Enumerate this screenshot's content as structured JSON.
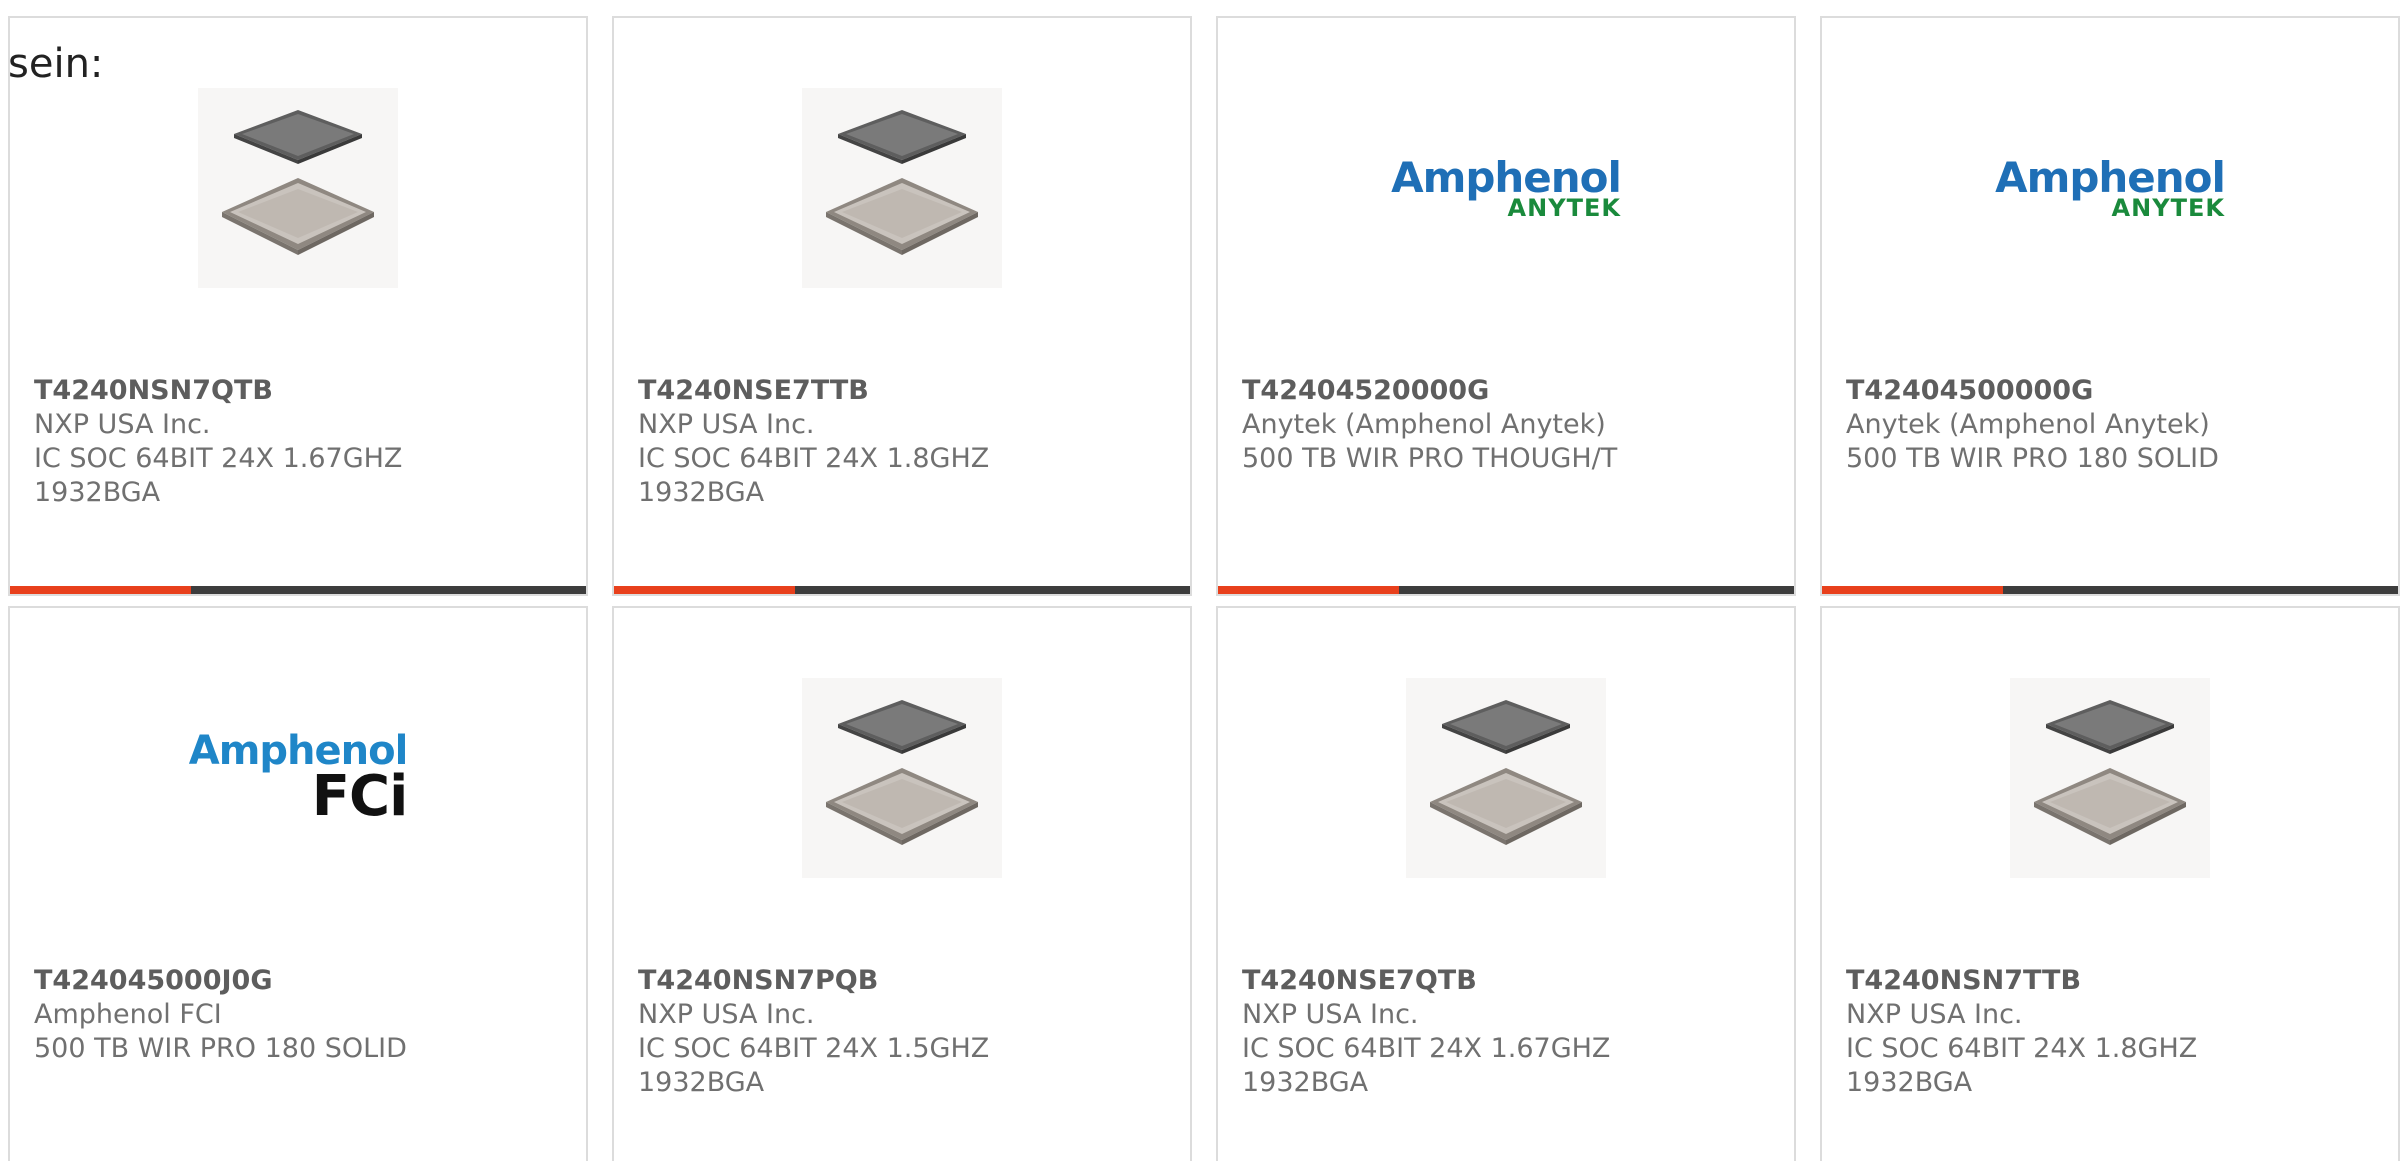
{
  "intro_text": "sein:",
  "products": [
    {
      "part": "T4240NSN7QTB",
      "manufacturer": "NXP USA Inc.",
      "description": [
        "IC SOC 64BIT 24X 1.67GHZ",
        "1932BGA"
      ],
      "image": "chip-package-icon",
      "bar": true
    },
    {
      "part": "T4240NSE7TTB",
      "manufacturer": "NXP USA Inc.",
      "description": [
        "IC SOC 64BIT 24X 1.8GHZ",
        "1932BGA"
      ],
      "image": "chip-package-icon",
      "bar": true
    },
    {
      "part": "T42404520000G",
      "manufacturer": "Anytek (Amphenol Anytek)",
      "description": [
        "500 TB WIR PRO THOUGH/T"
      ],
      "image": "amphenol-anytek-logo",
      "logo_text": [
        "Amphenol",
        "ANYTEK"
      ],
      "bar": true
    },
    {
      "part": "T42404500000G",
      "manufacturer": "Anytek (Amphenol Anytek)",
      "description": [
        "500 TB WIR PRO 180 SOLID"
      ],
      "image": "amphenol-anytek-logo",
      "logo_text": [
        "Amphenol",
        "ANYTEK"
      ],
      "bar": true
    },
    {
      "part": "T424045000J0G",
      "manufacturer": "Amphenol FCI",
      "description": [
        "500 TB WIR PRO 180 SOLID"
      ],
      "image": "amphenol-fci-logo",
      "logo_text": [
        "Amphenol",
        "FCi"
      ],
      "bar": false
    },
    {
      "part": "T4240NSN7PQB",
      "manufacturer": "NXP USA Inc.",
      "description": [
        "IC SOC 64BIT 24X 1.5GHZ",
        "1932BGA"
      ],
      "image": "chip-package-icon",
      "bar": false
    },
    {
      "part": "T4240NSE7QTB",
      "manufacturer": "NXP USA Inc.",
      "description": [
        "IC SOC 64BIT 24X 1.67GHZ",
        "1932BGA"
      ],
      "image": "chip-package-icon",
      "bar": false
    },
    {
      "part": "T4240NSN7TTB",
      "manufacturer": "NXP USA Inc.",
      "description": [
        "IC SOC 64BIT 24X 1.8GHZ",
        "1932BGA"
      ],
      "image": "chip-package-icon",
      "bar": false
    }
  ],
  "colors": {
    "accent": "#e8401c",
    "bar_dark": "#3d3d3d",
    "border": "#dcdcdc",
    "amphenol_blue": "#1f6fb6",
    "anytek_green": "#1a8a3c"
  }
}
